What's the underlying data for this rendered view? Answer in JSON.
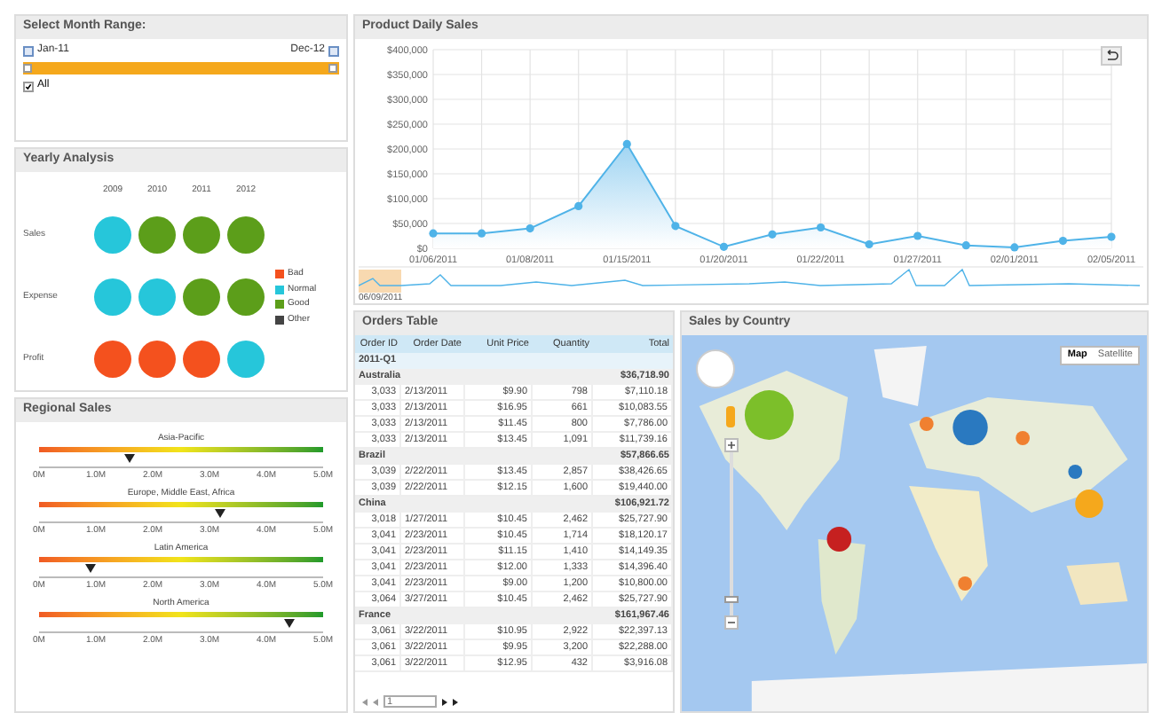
{
  "month_range": {
    "title": "Select Month Range:",
    "start": "Jan-11",
    "end": "Dec-12",
    "all": {
      "label": "All",
      "checked": true
    },
    "handles": [
      {
        "level": 0
      },
      {
        "level": 1
      }
    ]
  },
  "yearly": {
    "title": "Yearly Analysis",
    "years": [
      "2009",
      "2010",
      "2011",
      "2012"
    ],
    "rows": [
      {
        "label": "Sales",
        "circles": [
          {
            "color": "#26c6da"
          },
          {
            "color": "#5c9e1a"
          },
          {
            "color": "#5c9e1a"
          },
          {
            "color": "#5c9e1a"
          }
        ]
      },
      {
        "label": "Expense",
        "circles": [
          {
            "color": "#26c6da"
          },
          {
            "color": "#26c6da"
          },
          {
            "color": "#5c9e1a"
          },
          {
            "color": "#5c9e1a"
          }
        ]
      },
      {
        "label": "Profit",
        "circles": [
          {
            "color": "#f4511e"
          },
          {
            "color": "#f4511e"
          },
          {
            "color": "#f4511e"
          },
          {
            "color": "#26c6da"
          }
        ]
      }
    ],
    "legend": [
      {
        "label": "Bad",
        "color": "#f4511e"
      },
      {
        "label": "Normal",
        "color": "#26c6da"
      },
      {
        "label": "Good",
        "color": "#5c9e1a"
      },
      {
        "label": "Other",
        "color": "#444444"
      }
    ]
  },
  "regional": {
    "title": "Regional Sales",
    "gauges": [
      {
        "name": "Asia-Pacific",
        "level": 0.32,
        "ticks": [
          "0M",
          "1.0M",
          "2.0M",
          "3.0M",
          "4.0M",
          "5.0M"
        ]
      },
      {
        "name": "Europe, Middle East, Africa",
        "level": 0.64,
        "ticks": [
          "0M",
          "1.0M",
          "2.0M",
          "3.0M",
          "4.0M",
          "5.0M"
        ]
      },
      {
        "name": "Latin America",
        "level": 0.18,
        "ticks": [
          "0M",
          "1.0M",
          "2.0M",
          "3.0M",
          "4.0M",
          "5.0M"
        ]
      },
      {
        "name": "North America",
        "level": 0.88,
        "ticks": [
          "0M",
          "1.0M",
          "2.0M",
          "3.0M",
          "4.0M",
          "5.0M"
        ]
      }
    ]
  },
  "daily": {
    "title": "Product Daily Sales",
    "navigator_date": "06/09/2011",
    "chart_data": {
      "type": "area",
      "categories": [
        "01/06/2011",
        null,
        "01/08/2011",
        null,
        "01/15/2011",
        null,
        "01/20/2011",
        null,
        "01/22/2011",
        null,
        "01/27/2011",
        null,
        "02/01/2011",
        null,
        "02/05/2011"
      ],
      "grid": true,
      "series": [
        {
          "color": "#4fb3e8",
          "values": [
            30000,
            30000,
            40000,
            85000,
            210000,
            45000,
            3000,
            28000,
            42000,
            8000,
            25000,
            6000,
            2000,
            15000,
            23000
          ]
        }
      ],
      "ylim": [
        0,
        400000
      ],
      "yticks": [
        {
          "value": 0,
          "label": "$0"
        },
        {
          "value": 50000,
          "label": "$50,000"
        },
        {
          "value": 100000,
          "label": "$100,000"
        },
        {
          "value": 150000,
          "label": "$150,000"
        },
        {
          "value": 200000,
          "label": "$200,000"
        },
        {
          "value": 250000,
          "label": "$250,000"
        },
        {
          "value": 300000,
          "label": "$300,000"
        },
        {
          "value": 350000,
          "label": "$350,000"
        },
        {
          "value": 400000,
          "label": "$400,000"
        }
      ]
    }
  },
  "orders": {
    "title": "Orders Table",
    "columns": [
      "Order ID",
      "Order Date",
      "Unit Price",
      "Quantity",
      "Total"
    ],
    "period": "2011-Q1",
    "groups": [
      {
        "name": "Australia",
        "total": "$36,718.90",
        "rows": [
          [
            "3,033",
            "2/13/2011",
            "$9.90",
            "798",
            "$7,110.18"
          ],
          [
            "3,033",
            "2/13/2011",
            "$16.95",
            "661",
            "$10,083.55"
          ],
          [
            "3,033",
            "2/13/2011",
            "$11.45",
            "800",
            "$7,786.00"
          ],
          [
            "3,033",
            "2/13/2011",
            "$13.45",
            "1,091",
            "$11,739.16"
          ]
        ]
      },
      {
        "name": "Brazil",
        "total": "$57,866.65",
        "rows": [
          [
            "3,039",
            "2/22/2011",
            "$13.45",
            "2,857",
            "$38,426.65"
          ],
          [
            "3,039",
            "2/22/2011",
            "$12.15",
            "1,600",
            "$19,440.00"
          ]
        ]
      },
      {
        "name": "China",
        "total": "$106,921.72",
        "rows": [
          [
            "3,018",
            "1/27/2011",
            "$10.45",
            "2,462",
            "$25,727.90"
          ],
          [
            "3,041",
            "2/23/2011",
            "$10.45",
            "1,714",
            "$18,120.17"
          ],
          [
            "3,041",
            "2/23/2011",
            "$11.15",
            "1,410",
            "$14,149.35"
          ],
          [
            "3,041",
            "2/23/2011",
            "$12.00",
            "1,333",
            "$14,396.40"
          ],
          [
            "3,041",
            "2/23/2011",
            "$9.00",
            "1,200",
            "$10,800.00"
          ],
          [
            "3,064",
            "3/27/2011",
            "$10.45",
            "2,462",
            "$25,727.90"
          ]
        ]
      },
      {
        "name": "France",
        "total": "$161,967.46",
        "rows": [
          [
            "3,061",
            "3/22/2011",
            "$10.95",
            "2,922",
            "$22,397.13"
          ],
          [
            "3,061",
            "3/22/2011",
            "$9.95",
            "3,200",
            "$22,288.00"
          ],
          [
            "3,061",
            "3/22/2011",
            "$12.95",
            "432",
            "$3,916.08"
          ]
        ]
      }
    ],
    "page": "1"
  },
  "map": {
    "title": "Sales by Country",
    "zoom": {
      "level": 0.1
    },
    "types": [
      {
        "label": "Map",
        "selected": true
      },
      {
        "label": "Satellite",
        "selected": false
      }
    ]
  }
}
